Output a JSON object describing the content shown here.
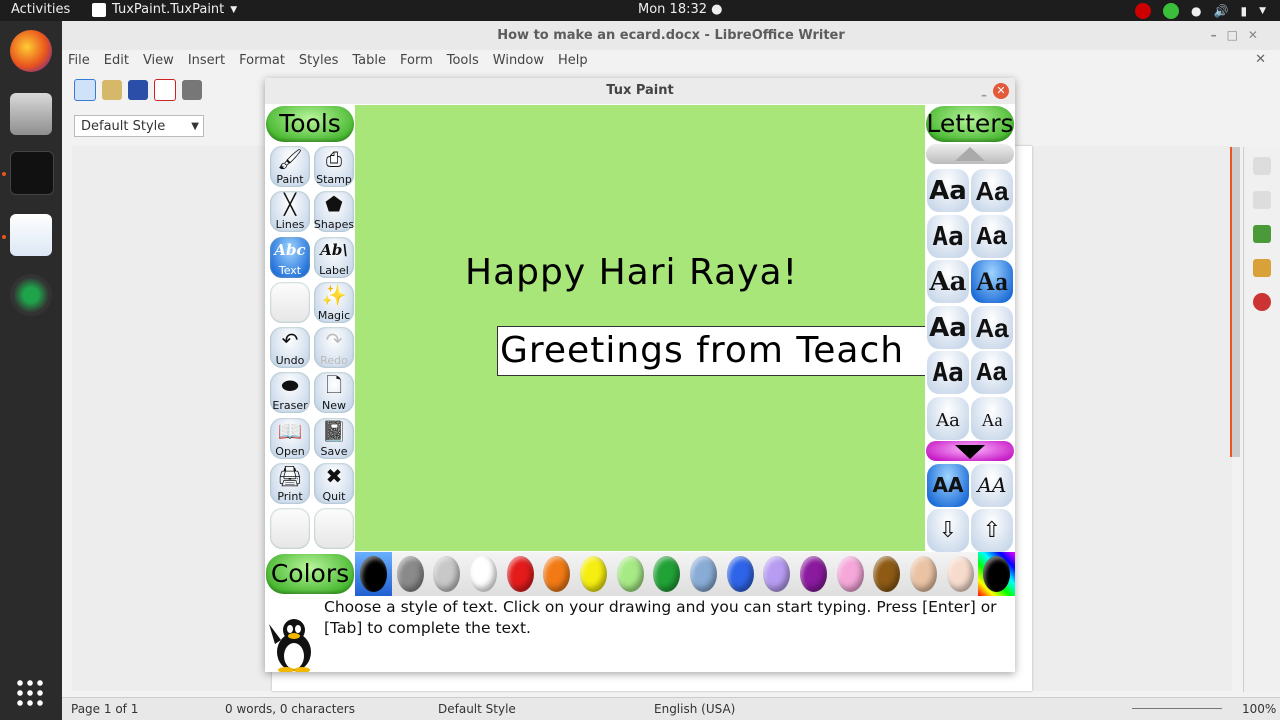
{
  "topbar": {
    "activities": "Activities",
    "app_name": "TuxPaint.TuxPaint",
    "clock": "Mon 18:32 ●"
  },
  "libreoffice": {
    "title": "How to make an ecard.docx - LibreOffice Writer",
    "menu": [
      "File",
      "Edit",
      "View",
      "Insert",
      "Format",
      "Styles",
      "Table",
      "Form",
      "Tools",
      "Window",
      "Help"
    ],
    "paragraph_style": "Default Style",
    "status": {
      "page": "Page 1 of 1",
      "words": "0 words, 0 characters",
      "style": "Default Style",
      "language": "English (USA)",
      "zoom": "100%"
    }
  },
  "tuxpaint": {
    "title": "Tux Paint",
    "tools_heading": "Tools",
    "letters_heading": "Letters",
    "colors_heading": "Colors",
    "tools": [
      {
        "label": "Paint",
        "icon": "brush-icon",
        "glyph": "🖌"
      },
      {
        "label": "Stamp",
        "icon": "stamp-icon",
        "glyph": "⎙"
      },
      {
        "label": "Lines",
        "icon": "lines-icon",
        "glyph": "╳"
      },
      {
        "label": "Shapes",
        "icon": "pentagon-icon",
        "glyph": "⬟"
      },
      {
        "label": "Text",
        "icon": "text-abc-icon",
        "glyph": "Abc",
        "selected": true
      },
      {
        "label": "Label",
        "icon": "label-abc-icon",
        "glyph": "Ab\\"
      },
      {
        "label": "",
        "icon": "blank-tool-icon",
        "glyph": ""
      },
      {
        "label": "Magic",
        "icon": "magic-wand-icon",
        "glyph": "✨"
      },
      {
        "label": "Undo",
        "icon": "undo-icon",
        "glyph": "↶"
      },
      {
        "label": "Redo",
        "icon": "redo-icon",
        "glyph": "↷",
        "disabled": true
      },
      {
        "label": "Eraser",
        "icon": "eraser-icon",
        "glyph": "⬬"
      },
      {
        "label": "New",
        "icon": "new-page-icon",
        "glyph": "🗋"
      },
      {
        "label": "Open",
        "icon": "open-book-icon",
        "glyph": "📖"
      },
      {
        "label": "Save",
        "icon": "save-book-icon",
        "glyph": "📓"
      },
      {
        "label": "Print",
        "icon": "printer-icon",
        "glyph": "🖨"
      },
      {
        "label": "Quit",
        "icon": "quit-x-icon",
        "glyph": "✖"
      },
      {
        "label": "",
        "icon": "blank-tool-icon",
        "glyph": ""
      },
      {
        "label": "",
        "icon": "blank-tool-icon",
        "glyph": ""
      }
    ],
    "fonts": [
      "Aa",
      "Aa",
      "Aa",
      "Aa",
      "Aa",
      "Aa",
      "Aa",
      "Aa",
      "Aa",
      "Aa",
      "Aa",
      "Aa"
    ],
    "selected_font_index": 5,
    "font_controls": [
      "AA",
      "AA"
    ],
    "canvas": {
      "background": "#a8e67a",
      "text_1": "Happy Hari Raya!",
      "text_2": "Greetings from Teach"
    },
    "colors": [
      "#000000",
      "#8a8a8a",
      "#c8c8c8",
      "#ffffff",
      "#e41b1b",
      "#f27a14",
      "#f5ee10",
      "#a6ea86",
      "#21a236",
      "#88acd6",
      "#2e64e8",
      "#b79cf2",
      "#8a1a9e",
      "#f5a7d9",
      "#8e5a14",
      "#e9c3a4",
      "#f7dccd",
      "rainbow"
    ],
    "tip": "Choose a style of text. Click on your drawing and you can start typing. Press [Enter] or [Tab] to complete the text."
  }
}
